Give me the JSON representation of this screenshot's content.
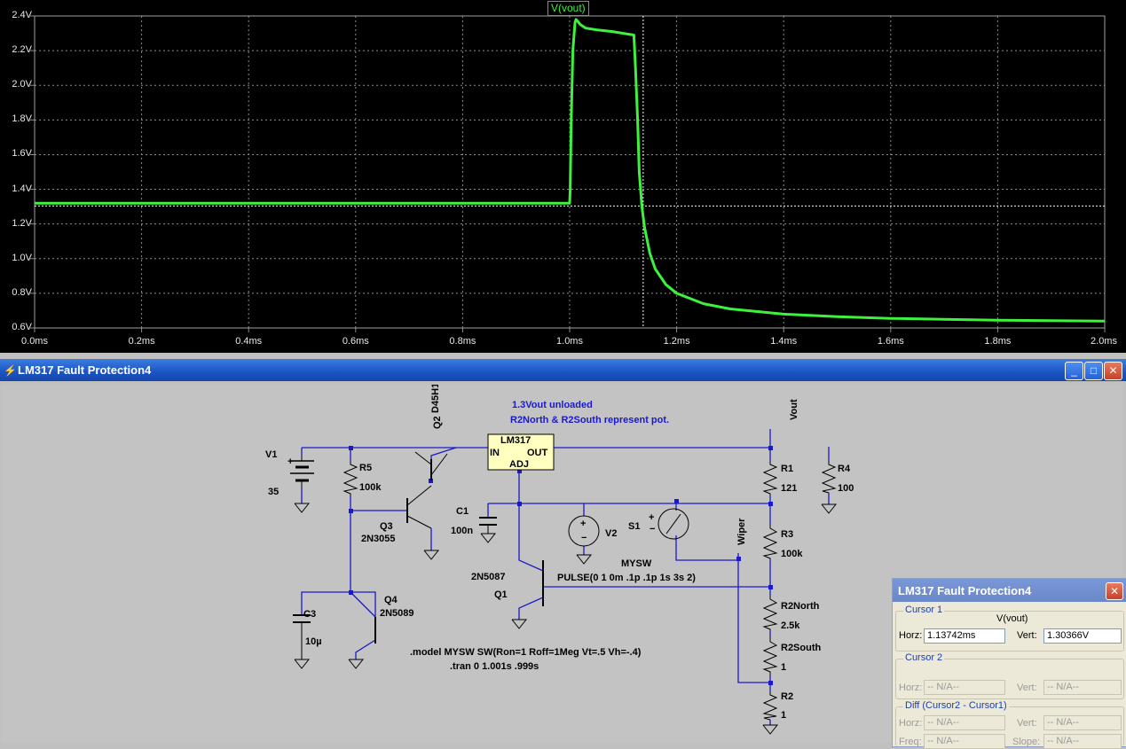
{
  "plot": {
    "trace_name": "V(vout)",
    "colors": {
      "background": "#000000",
      "trace": "#3df23d",
      "grid": "#8c8c8c",
      "cursor": "#ffffff"
    },
    "cursor_time_ms": 1.13742,
    "cursor_value_v": 1.30366
  },
  "chart_data": {
    "type": "line",
    "title": "V(vout)",
    "xlabel": "",
    "ylabel": "",
    "xlim": [
      0.0,
      2.0
    ],
    "ylim": [
      0.6,
      2.4
    ],
    "x_ticks": [
      "0.0ms",
      "0.2ms",
      "0.4ms",
      "0.6ms",
      "0.8ms",
      "1.0ms",
      "1.2ms",
      "1.4ms",
      "1.6ms",
      "1.8ms",
      "2.0ms"
    ],
    "y_ticks": [
      "0.6V",
      "0.8V",
      "1.0V",
      "1.2V",
      "1.4V",
      "1.6V",
      "1.8V",
      "2.0V",
      "2.2V",
      "2.4V"
    ],
    "grid": true,
    "series": [
      {
        "name": "V(vout)",
        "x": [
          0.0,
          0.5,
          1.0,
          1.001,
          1.003,
          1.006,
          1.01,
          1.012,
          1.015,
          1.02,
          1.03,
          1.05,
          1.08,
          1.1,
          1.12,
          1.123,
          1.127,
          1.13,
          1.135,
          1.14,
          1.15,
          1.16,
          1.18,
          1.2,
          1.25,
          1.3,
          1.4,
          1.5,
          1.6,
          1.7,
          1.8,
          1.9,
          2.0
        ],
        "y": [
          1.32,
          1.32,
          1.32,
          1.4,
          1.8,
          2.2,
          2.36,
          2.38,
          2.37,
          2.35,
          2.33,
          2.32,
          2.31,
          2.3,
          2.29,
          2.1,
          1.8,
          1.5,
          1.3,
          1.18,
          1.03,
          0.94,
          0.85,
          0.8,
          0.74,
          0.71,
          0.68,
          0.665,
          0.655,
          0.65,
          0.645,
          0.642,
          0.64
        ]
      }
    ]
  },
  "schematic": {
    "title": "LM317 Fault Protection4",
    "icon": "ltspice-icon",
    "window_buttons": {
      "minimize": "_",
      "maximize": "□",
      "close": "✕"
    },
    "notes": [
      "1.3Vout unloaded",
      "R2North & R2South represent pot."
    ],
    "directives": [
      ".model MYSW SW(Ron=1 Roff=1Meg Vt=.5 Vh=-.4)",
      ".tran 0 1.001s .999s"
    ],
    "labels": {
      "vout": "Vout",
      "wiper": "Wiper",
      "v1": "V1",
      "v1_value": "35",
      "v2": "V2",
      "r5": "R5",
      "r5_value": "100k",
      "q2": "Q2",
      "q2_model": "D45H11",
      "q3": "Q3",
      "q3_model": "2N3055",
      "q4": "Q4",
      "q4_model": "2N5089",
      "q1": "Q1",
      "q1_model": "2N5087",
      "c1": "C1",
      "c1_value": "100n",
      "c3": "C3",
      "c3_value": "10µ",
      "lm317": "LM317",
      "pin_in": "IN",
      "pin_out": "OUT",
      "pin_adj": "ADJ",
      "r1": "R1",
      "r1_value": "121",
      "r4": "R4",
      "r4_value": "100",
      "r3": "R3",
      "r3_value": "100k",
      "r2north": "R2North",
      "r2north_value": "2.5k",
      "r2south": "R2South",
      "r2south_value": "1",
      "r2": "R2",
      "r2_value": "1",
      "s1": "S1",
      "s1_model": "MYSW",
      "v2_pulse": "PULSE(0 1 0m .1p .1p 1s 3s 2)"
    }
  },
  "cursor_dialog": {
    "title": "LM317 Fault Protection4",
    "close": "✕",
    "cursor1": {
      "label": "Cursor 1",
      "trace": "V(vout)",
      "horz_label": "Horz:",
      "horz": "1.13742ms",
      "vert_label": "Vert:",
      "vert": "1.30366V"
    },
    "cursor2": {
      "label": "Cursor 2",
      "horz_label": "Horz:",
      "horz": "-- N/A--",
      "vert_label": "Vert:",
      "vert": "-- N/A--"
    },
    "diff": {
      "label": "Diff (Cursor2 - Cursor1)",
      "horz_label": "Horz:",
      "horz": "-- N/A--",
      "vert_label": "Vert:",
      "vert": "-- N/A--",
      "freq_label": "Freq:",
      "freq": "-- N/A--",
      "slope_label": "Slope:",
      "slope": "-- N/A--"
    }
  }
}
